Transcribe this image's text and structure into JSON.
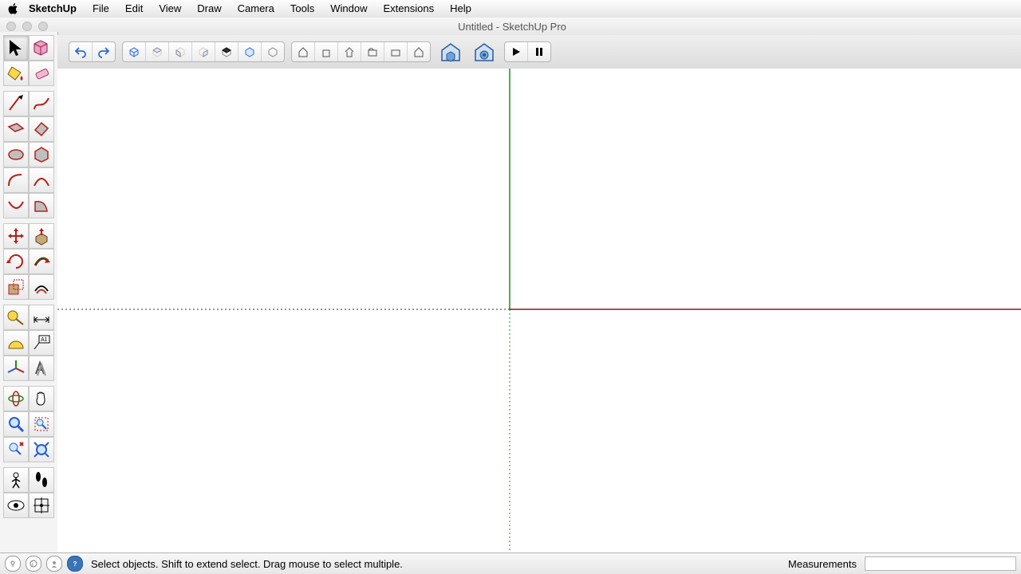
{
  "menubar": {
    "app": "SketchUp",
    "items": [
      "File",
      "Edit",
      "View",
      "Draw",
      "Camera",
      "Tools",
      "Window",
      "Extensions",
      "Help"
    ]
  },
  "window": {
    "title": "Untitled - SketchUp Pro"
  },
  "status": {
    "hint": "Select objects. Shift to extend select. Drag mouse to select multiple.",
    "measurements_label": "Measurements",
    "measurements_value": ""
  },
  "top_toolbar": {
    "undo": "Undo",
    "redo": "Redo",
    "views": [
      "Iso",
      "Top",
      "Front",
      "Right",
      "Back",
      "Left",
      "Bottom"
    ],
    "scene_actions": [
      "Add Scene",
      "Update Scene",
      "Previous Scene",
      "Next Scene",
      "Delete Scene",
      "Scene Manager"
    ],
    "warehouse": "3D Warehouse",
    "extension_warehouse": "Extension Warehouse",
    "play": "Play",
    "pause": "Pause"
  },
  "toolbox": {
    "tools": [
      [
        "Select",
        "Make Component"
      ],
      [
        "Paint Bucket",
        "Eraser"
      ],
      [
        "Line",
        "Freehand"
      ],
      [
        "Rectangle",
        "Rotated Rectangle"
      ],
      [
        "Circle",
        "Polygon"
      ],
      [
        "Arc",
        "2 Point Arc"
      ],
      [
        "3 Point Arc",
        "Pie"
      ],
      [
        "Move",
        "Push/Pull"
      ],
      [
        "Rotate",
        "Follow Me"
      ],
      [
        "Scale",
        "Offset"
      ],
      [
        "Tape Measure",
        "Dimension"
      ],
      [
        "Protractor",
        "Text"
      ],
      [
        "Axes",
        "3D Text"
      ],
      [
        "Orbit",
        "Pan"
      ],
      [
        "Zoom",
        "Zoom Window"
      ],
      [
        "Previous",
        "Zoom Extents"
      ],
      [
        "Position Camera",
        "Walk"
      ],
      [
        "Look Around",
        "Section Plane"
      ]
    ]
  },
  "colors": {
    "axis_green": "#1c8f1c",
    "axis_red": "#b5201a",
    "axis_pos": "solid",
    "axis_neg": "dotted"
  }
}
